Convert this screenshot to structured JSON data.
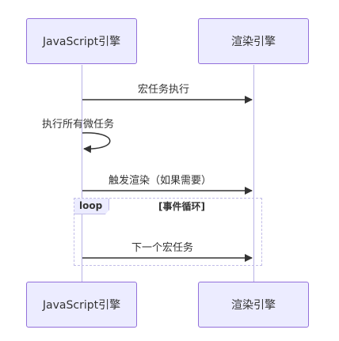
{
  "actors": {
    "js_engine": "JavaScript引擎",
    "render_engine": "渲染引擎"
  },
  "messages": {
    "macro_task": "宏任务执行",
    "all_micro_tasks": "执行所有微任务",
    "trigger_render": "触发渲染（如果需要）",
    "next_macro_task": "下一个宏任务"
  },
  "loop": {
    "keyword": "loop",
    "condition": "[事件循环]"
  },
  "colors": {
    "actor_fill": "#ECECFF",
    "actor_border": "#9370DB",
    "line": "#333333"
  }
}
